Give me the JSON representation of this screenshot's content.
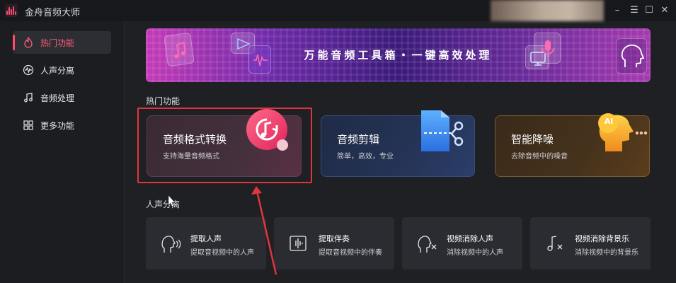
{
  "titlebar": {
    "app_name": "金舟音频大师",
    "minimize": "–",
    "menu": "☰",
    "maximize": "☐",
    "close": "✕"
  },
  "sidebar": {
    "items": [
      {
        "label": "热门功能",
        "icon": "fire-icon",
        "active": true
      },
      {
        "label": "人声分离",
        "icon": "waveform-icon",
        "active": false
      },
      {
        "label": "音频处理",
        "icon": "music-note-icon",
        "active": false
      },
      {
        "label": "更多功能",
        "icon": "grid-icon",
        "active": false
      }
    ]
  },
  "banner": {
    "slogan": "万能音频工具箱・一键高效处理"
  },
  "hot": {
    "section_title": "热门功能",
    "cards": [
      {
        "title": "音频格式转换",
        "subtitle": "支持海量音频格式",
        "icon": "music-convert-icon"
      },
      {
        "title": "音频剪辑",
        "subtitle": "简单，高效，专业",
        "icon": "scissors-file-icon"
      },
      {
        "title": "智能降噪",
        "subtitle": "去除音频中的噪音",
        "icon": "ai-head-icon",
        "badge": "AI"
      }
    ]
  },
  "vocal": {
    "section_title": "人声分离",
    "cards": [
      {
        "title": "提取人声",
        "subtitle": "提取音视频中的人声",
        "icon": "voice-head-icon"
      },
      {
        "title": "提取伴奏",
        "subtitle": "提取音视频中的伴奏",
        "icon": "waveform-box-icon"
      },
      {
        "title": "视频消除人声",
        "subtitle": "消除视频中的人声",
        "icon": "voice-remove-icon"
      },
      {
        "title": "视频消除背景乐",
        "subtitle": "消除视频中的背景乐",
        "icon": "music-remove-icon"
      }
    ]
  },
  "colors": {
    "accent": "#ff4a6e",
    "highlight_box": "#e0353a"
  }
}
